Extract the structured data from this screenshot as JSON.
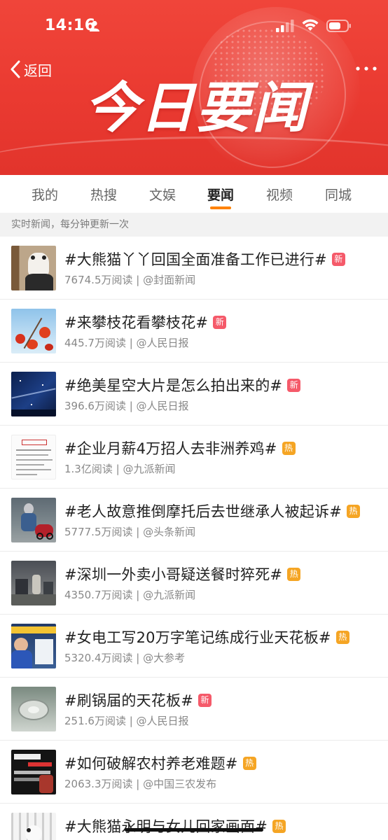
{
  "status_bar": {
    "time": "14:16"
  },
  "header": {
    "back_label": "返回",
    "banner_title": "今日要闻",
    "banner_color": "#ea3a31"
  },
  "tabs": [
    {
      "label": "我的",
      "active": false
    },
    {
      "label": "热搜",
      "active": false
    },
    {
      "label": "文娱",
      "active": false
    },
    {
      "label": "要闻",
      "active": true
    },
    {
      "label": "视频",
      "active": false
    },
    {
      "label": "同城",
      "active": false
    }
  ],
  "accent_color": "#ff8200",
  "notice": "实时新闻，每分钟更新一次",
  "badges": {
    "new": {
      "label": "新",
      "color": "#f55a6a"
    },
    "hot": {
      "label": "热",
      "color": "#f5a524"
    }
  },
  "news": [
    {
      "title": "#大熊猫丫丫回国全面准备工作已进行#",
      "badge": "new",
      "reads": "7674.5万阅读",
      "source": "@封面新闻",
      "thumb": "panda-photo"
    },
    {
      "title": "#来攀枝花看攀枝花#",
      "badge": "new",
      "reads": "445.7万阅读",
      "source": "@人民日报",
      "thumb": "kapok-flowers-photo"
    },
    {
      "title": "#绝美星空大片是怎么拍出来的#",
      "badge": "new",
      "reads": "396.6万阅读",
      "source": "@人民日报",
      "thumb": "starry-sky-photo"
    },
    {
      "title": "#企业月薪4万招人去非洲养鸡#",
      "badge": "hot",
      "reads": "1.3亿阅读",
      "source": "@九派新闻",
      "thumb": "job-notice-document"
    },
    {
      "title": "#老人故意推倒摩托后去世继承人被起诉#",
      "badge": "hot",
      "reads": "5777.5万阅读",
      "source": "@头条新闻",
      "thumb": "motorcycle-street-photo"
    },
    {
      "title": "#深圳一外卖小哥疑送餐时猝死#",
      "badge": "hot",
      "reads": "4350.7万阅读",
      "source": "@九派新闻",
      "thumb": "street-scene-photo"
    },
    {
      "title": "#女电工写20万字笔记练成行业天花板#",
      "badge": "hot",
      "reads": "5320.4万阅读",
      "source": "@大参考",
      "thumb": "electrician-photo"
    },
    {
      "title": "#刷锅届的天花板#",
      "badge": "new",
      "reads": "251.6万阅读",
      "source": "@人民日报",
      "thumb": "pot-cleaning-photo"
    },
    {
      "title": "#如何破解农村养老难题#",
      "badge": "hot",
      "reads": "2063.3万阅读",
      "source": "@中国三农发布",
      "thumb": "rural-elderly-poster"
    },
    {
      "title": "#大熊猫永明与女儿回家画面#",
      "badge": "hot",
      "reads": "",
      "source": "",
      "thumb": "panda-cage-photo"
    }
  ]
}
